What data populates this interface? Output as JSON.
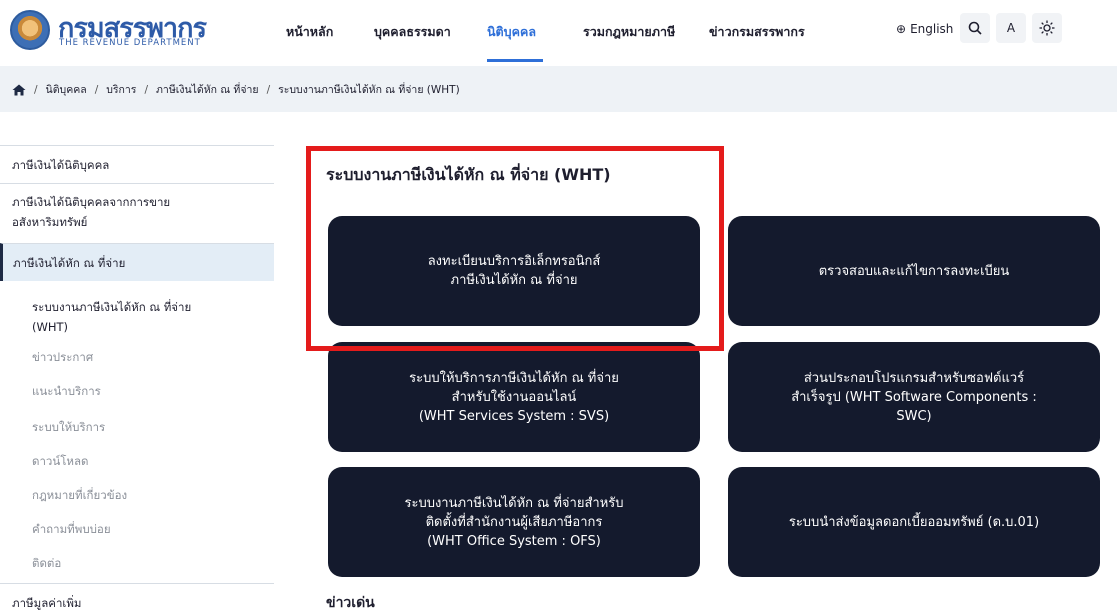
{
  "header": {
    "logo_title": "กรมสรรพากร",
    "logo_subtitle": "THE REVENUE DEPARTMENT",
    "nav": [
      {
        "label": "หน้าหลัก"
      },
      {
        "label": "บุคคลธรรมดา"
      },
      {
        "label": "นิติบุคคล",
        "active": true
      },
      {
        "label": "รวมกฎหมายภาษี"
      },
      {
        "label": "ข่าวกรมสรรพากร"
      }
    ],
    "language_label": "English",
    "icons": {
      "globe": "globe-icon",
      "search": "search-icon",
      "font": "font-size-icon",
      "theme": "brightness-icon"
    },
    "font_button_label": "A"
  },
  "breadcrumb": {
    "items": [
      "นิติบุคคล",
      "บริการ",
      "ภาษีเงินได้หัก ณ ที่จ่าย",
      "ระบบงานภาษีเงินได้หัก ณ ที่จ่าย (WHT)"
    ]
  },
  "sidebar": {
    "items": [
      {
        "label": "ภาษีเงินได้นิติบุคคล"
      },
      {
        "label_line1": "ภาษีเงินได้นิติบุคคลจากการขาย",
        "label_line2": "อสังหาริมทรัพย์"
      },
      {
        "label": "ภาษีเงินได้หัก ณ ที่จ่าย",
        "active": true
      }
    ],
    "sub_items": [
      {
        "label_line1": "ระบบงานภาษีเงินได้หัก ณ ที่จ่าย",
        "label_line2": "(WHT)"
      },
      {
        "label": "ข่าวประกาศ"
      },
      {
        "label": "แนะนำบริการ"
      },
      {
        "label": "ระบบให้บริการ"
      },
      {
        "label": "ดาวน์โหลด"
      },
      {
        "label": "กฎหมายที่เกี่ยวข้อง"
      },
      {
        "label": "คำถามที่พบบ่อย"
      },
      {
        "label": "ติดต่อ"
      }
    ],
    "bottom_item": "ภาษีมูลค่าเพิ่ม"
  },
  "main": {
    "title": "ระบบงานภาษีเงินได้หัก ณ ที่จ่าย (WHT)",
    "tiles": [
      {
        "line1": "ลงทะเบียนบริการอิเล็กทรอนิกส์",
        "line2": "ภาษีเงินได้หัก ณ ที่จ่าย",
        "line3": ""
      },
      {
        "line1": "ตรวจสอบและแก้ไขการลงทะเบียน",
        "line2": "",
        "line3": ""
      },
      {
        "line1": "ระบบให้บริการภาษีเงินได้หัก ณ ที่จ่าย",
        "line2": "สำหรับใช้งานออนไลน์",
        "line3": "(WHT Services System : SVS)"
      },
      {
        "line1": "ส่วนประกอบโปรแกรมสำหรับซอฟต์แวร์",
        "line2": "สำเร็จรูป (WHT Software Components :",
        "line3": "SWC)"
      },
      {
        "line1": "ระบบงานภาษีเงินได้หัก ณ ที่จ่ายสำหรับ",
        "line2": "ติดตั้งที่สำนักงานผู้เสียภาษีอากร",
        "line3": "(WHT Office System : OFS)"
      },
      {
        "line1": "ระบบนำส่งข้อมูลดอกเบี้ยออมทรัพย์ (ด.บ.01)",
        "line2": "",
        "line3": ""
      }
    ],
    "news_title": "ข่าวเด่น",
    "highlight_color": "#e41b1b",
    "tile_color": "#141a2d"
  }
}
